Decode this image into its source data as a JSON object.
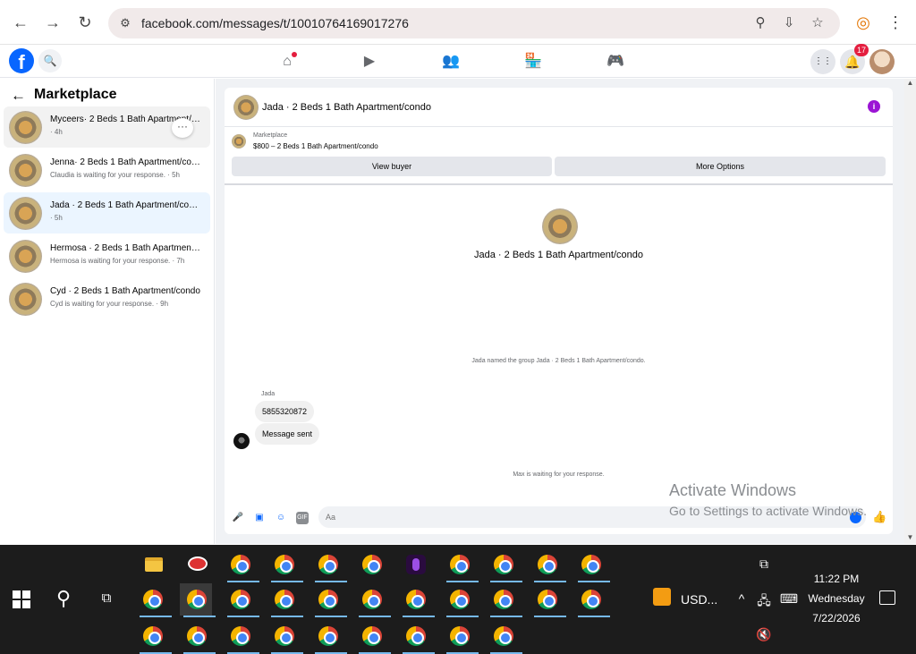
{
  "browser": {
    "url": "facebook.com/messages/t/10010764169017276",
    "back_icon": "←",
    "forward_icon": "→",
    "reload_icon": "↻",
    "tune_icon": "⚙",
    "zoom_icon": "⚲",
    "install_icon": "⇩",
    "star_icon": "☆",
    "profile_icon": "◎",
    "menu_icon": "⋮"
  },
  "fb": {
    "logo": "f",
    "search_icon": "🔍",
    "nav_icons": {
      "home": "⌂",
      "video": "▶",
      "friends": "👥",
      "marketplace": "🏪",
      "gaming": "🎮"
    },
    "apps_icon": "⋮⋮",
    "bell_icon": "🔔",
    "notif_count": "17"
  },
  "sidebar": {
    "title": "Marketplace",
    "back_icon": "←",
    "more_icon": "···",
    "conversations": [
      {
        "name": "Myceers· 2 Beds 1 Bath Apartment/condo",
        "sub": "· 4h"
      },
      {
        "name": "Jenna· 2 Beds 1 Bath Apartment/condo",
        "sub": "Claudia is waiting for your response. · 5h"
      },
      {
        "name": "Jada · 2 Beds 1 Bath Apartment/condo",
        "sub": "· 5h"
      },
      {
        "name": "Hermosa · 2 Beds 1 Bath Apartment/condo",
        "sub": "Hermosa is waiting for your response. · 7h"
      },
      {
        "name": "Cyd · 2 Beds 1 Bath Apartment/condo",
        "sub": "Cyd is waiting for your response. · 9h"
      }
    ]
  },
  "chat": {
    "header_title": "Jada · 2 Beds 1 Bath Apartment/condo",
    "info_icon": "i",
    "listing_category": "Marketplace",
    "listing_title": "$800 – 2 Beds 1 Bath Apartment/condo",
    "view_buyer": "View buyer",
    "more_options": "More Options",
    "center_name": "Jada · 2 Beds 1 Bath Apartment/condo",
    "system_msg": "Jada named the group Jada · 2 Beds 1 Bath Apartment/condo.",
    "sender": "Jada",
    "messages": [
      "5855320872",
      "Message sent"
    ],
    "waiting": "Max is waiting for your response.",
    "composer_placeholder": "Aa",
    "composer_icons": {
      "mic": "🎤",
      "photo": "▣",
      "sticker": "☺",
      "gif": "GIF"
    },
    "like_icon": "👍"
  },
  "watermark": {
    "line1": "Activate Windows",
    "line2": "Go to Settings to activate Windows."
  },
  "scrollbar": {
    "up": "▲",
    "down": "▼"
  },
  "taskbar": {
    "search_icon": "⚲",
    "taskview_icon": "⧉",
    "currency": "USD...",
    "chevron_icon": "^",
    "network_icon": "🖧",
    "keyboard_icon": "⌨",
    "volume_icon": "🔇",
    "meet_icon": "⧉",
    "time": "11:22 PM",
    "day": "Wednesday",
    "date": "7/22/2026"
  }
}
